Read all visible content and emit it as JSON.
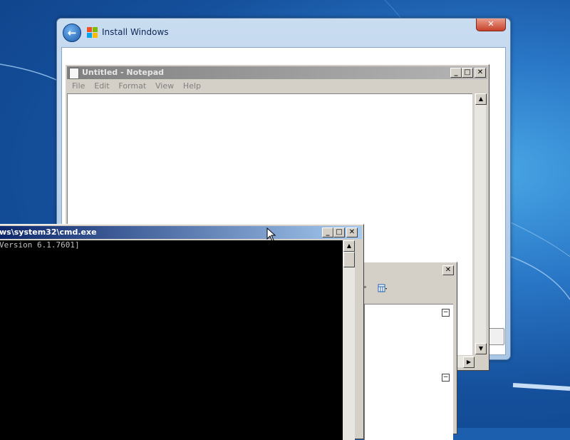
{
  "install_window": {
    "title": "Install Windows",
    "close_label": "✕",
    "back_label": "←"
  },
  "notepad": {
    "title": "Untitled - Notepad",
    "menu": [
      "File",
      "Edit",
      "Format",
      "View",
      "Help"
    ],
    "buttons": {
      "minimize": "_",
      "maximize": "□",
      "close": "✕"
    }
  },
  "cmd": {
    "title": "ws\\system32\\cmd.exe",
    "output_line": "Version 6.1.7601]",
    "buttons": {
      "minimize": "_",
      "maximize": "□",
      "close": "✕"
    }
  },
  "dialog": {
    "close": "✕",
    "expand_symbol": "−"
  },
  "colors": {
    "desktop_blue": "#1c5fae",
    "cmd_titlebar": "#0a246a",
    "inactive_titlebar": "#808080",
    "close_red": "#c8412a"
  }
}
